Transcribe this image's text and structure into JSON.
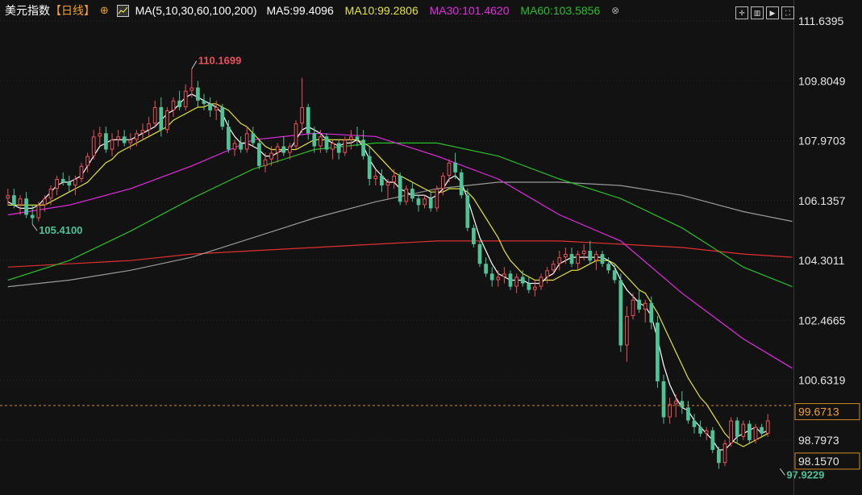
{
  "header": {
    "title": "美元指数",
    "period": "【日线】",
    "settings_icon": "gear-icon",
    "ma_params": "MA(5,10,30,60,100,200)",
    "ma5": "MA5:99.4096",
    "ma10": "MA10:99.2806",
    "ma30": "MA30:101.4620",
    "ma60": "MA60:103.5856",
    "collapse": "⊗",
    "toolbar_icons": [
      "crosshair-icon",
      "panel-icon",
      "play-icon",
      "fullscreen-icon"
    ]
  },
  "colors": {
    "background": "#121212",
    "grid": "#2a2a2a",
    "up": "#e8525a",
    "down": "#4ec397",
    "ma5": "#ffffff",
    "ma10": "#e4e43a",
    "ma30": "#e42be0",
    "ma60": "#2bbf2b",
    "ma100": "#9a9a9a",
    "ma200": "#e03030",
    "title": "#ffffff",
    "period": "#f0a030"
  },
  "chart_data": {
    "type": "candlestick",
    "ylim": [
      97.6,
      111.9
    ],
    "y_ticks": [
      "111.6395",
      "109.8049",
      "107.9703",
      "106.1357",
      "104.3011",
      "102.4665",
      "100.6319",
      "98.7973"
    ],
    "y_tick_values": [
      111.6395,
      109.8049,
      107.9703,
      106.1357,
      104.3011,
      102.4665,
      100.6319,
      98.7973
    ],
    "current_price": "99.6713",
    "current_value": 99.6713,
    "min_label": "98.1570",
    "min_value": 98.157,
    "annotations": [
      {
        "label": "110.1699",
        "index": 30,
        "value": 110.1699,
        "kind": "high"
      },
      {
        "label": "105.4100",
        "index": 4,
        "value": 105.41,
        "kind": "low"
      },
      {
        "label": "97.9229",
        "index": 126,
        "value": 97.9229,
        "kind": "low"
      }
    ],
    "ohlc": [
      [
        106.2,
        106.5,
        106.0,
        106.3
      ],
      [
        106.3,
        106.5,
        105.9,
        106.0
      ],
      [
        106.0,
        106.3,
        105.7,
        106.2
      ],
      [
        106.2,
        106.4,
        105.6,
        105.7
      ],
      [
        105.7,
        106.0,
        105.41,
        105.6
      ],
      [
        105.6,
        106.1,
        105.5,
        106.0
      ],
      [
        106.0,
        106.3,
        105.8,
        106.2
      ],
      [
        106.2,
        106.6,
        106.0,
        106.5
      ],
      [
        106.5,
        106.9,
        106.3,
        106.8
      ],
      [
        106.8,
        107.0,
        106.6,
        106.7
      ],
      [
        106.7,
        106.9,
        106.4,
        106.6
      ],
      [
        106.6,
        106.9,
        106.3,
        106.8
      ],
      [
        106.8,
        107.3,
        106.7,
        107.2
      ],
      [
        107.2,
        107.6,
        107.0,
        107.5
      ],
      [
        107.5,
        108.3,
        107.4,
        108.1
      ],
      [
        108.1,
        108.4,
        107.8,
        108.2
      ],
      [
        108.2,
        108.4,
        107.6,
        107.7
      ],
      [
        107.7,
        108.2,
        107.5,
        108.0
      ],
      [
        108.0,
        108.3,
        107.8,
        108.1
      ],
      [
        108.1,
        108.3,
        107.8,
        107.9
      ],
      [
        107.9,
        108.2,
        107.7,
        108.0
      ],
      [
        108.0,
        108.3,
        107.8,
        108.2
      ],
      [
        108.2,
        108.5,
        108.0,
        108.3
      ],
      [
        108.3,
        108.7,
        108.1,
        108.5
      ],
      [
        108.5,
        109.2,
        108.4,
        109.0
      ],
      [
        109.0,
        109.3,
        108.1,
        108.3
      ],
      [
        108.3,
        109.0,
        108.2,
        108.9
      ],
      [
        108.9,
        109.3,
        108.7,
        109.2
      ],
      [
        109.2,
        109.5,
        108.9,
        109.0
      ],
      [
        109.0,
        109.7,
        108.9,
        109.5
      ],
      [
        109.5,
        110.17,
        109.3,
        109.6
      ],
      [
        109.6,
        109.8,
        109.0,
        109.2
      ],
      [
        109.2,
        109.4,
        108.9,
        109.1
      ],
      [
        109.1,
        109.3,
        108.7,
        108.9
      ],
      [
        108.9,
        109.2,
        108.6,
        109.0
      ],
      [
        109.0,
        109.1,
        108.3,
        108.4
      ],
      [
        108.4,
        108.6,
        107.6,
        107.7
      ],
      [
        107.7,
        108.0,
        107.5,
        107.9
      ],
      [
        107.9,
        108.1,
        107.6,
        107.7
      ],
      [
        107.7,
        108.4,
        107.6,
        108.2
      ],
      [
        108.2,
        108.4,
        107.8,
        107.9
      ],
      [
        107.9,
        108.0,
        107.1,
        107.2
      ],
      [
        107.2,
        107.6,
        107.0,
        107.4
      ],
      [
        107.4,
        107.8,
        107.2,
        107.6
      ],
      [
        107.6,
        107.9,
        107.3,
        107.8
      ],
      [
        107.8,
        108.1,
        107.5,
        107.6
      ],
      [
        107.6,
        107.9,
        107.4,
        107.8
      ],
      [
        107.8,
        108.6,
        107.7,
        108.5
      ],
      [
        108.5,
        109.9,
        108.2,
        109.0
      ],
      [
        109.0,
        109.1,
        108.0,
        108.2
      ],
      [
        108.2,
        108.4,
        107.6,
        107.8
      ],
      [
        107.8,
        108.3,
        107.6,
        108.1
      ],
      [
        108.1,
        108.2,
        107.6,
        107.7
      ],
      [
        107.7,
        108.0,
        107.4,
        107.9
      ],
      [
        107.9,
        108.0,
        107.4,
        107.6
      ],
      [
        107.6,
        108.1,
        107.5,
        108.0
      ],
      [
        108.0,
        108.3,
        107.7,
        108.1
      ],
      [
        108.1,
        108.4,
        107.8,
        108.0
      ],
      [
        108.0,
        108.3,
        107.4,
        107.5
      ],
      [
        107.5,
        107.8,
        106.6,
        106.8
      ],
      [
        106.8,
        107.1,
        106.6,
        106.9
      ],
      [
        106.9,
        107.1,
        106.4,
        106.6
      ],
      [
        106.6,
        106.8,
        106.2,
        106.7
      ],
      [
        106.7,
        107.1,
        106.5,
        106.9
      ],
      [
        106.9,
        107.0,
        106.0,
        106.1
      ],
      [
        106.1,
        106.6,
        106.0,
        106.5
      ],
      [
        106.5,
        106.7,
        106.1,
        106.2
      ],
      [
        106.2,
        106.3,
        105.8,
        106.0
      ],
      [
        106.0,
        106.3,
        105.9,
        106.2
      ],
      [
        106.2,
        106.4,
        105.8,
        105.9
      ],
      [
        105.9,
        106.6,
        105.8,
        106.5
      ],
      [
        106.5,
        107.0,
        106.3,
        106.9
      ],
      [
        106.9,
        107.4,
        106.7,
        107.3
      ],
      [
        107.3,
        107.6,
        106.8,
        107.0
      ],
      [
        107.0,
        107.1,
        106.2,
        106.3
      ],
      [
        106.3,
        106.5,
        105.2,
        105.3
      ],
      [
        105.3,
        105.4,
        104.7,
        104.8
      ],
      [
        104.8,
        104.9,
        104.1,
        104.2
      ],
      [
        104.2,
        104.4,
        103.8,
        103.9
      ],
      [
        103.9,
        104.1,
        103.5,
        103.7
      ],
      [
        103.7,
        104.0,
        103.5,
        103.8
      ],
      [
        103.8,
        104.1,
        103.6,
        103.9
      ],
      [
        103.9,
        104.0,
        103.4,
        103.5
      ],
      [
        103.5,
        103.9,
        103.3,
        103.8
      ],
      [
        103.8,
        104.0,
        103.5,
        103.6
      ],
      [
        103.6,
        103.8,
        103.3,
        103.4
      ],
      [
        103.4,
        103.7,
        103.2,
        103.5
      ],
      [
        103.5,
        103.9,
        103.4,
        103.8
      ],
      [
        103.8,
        104.1,
        103.6,
        104.0
      ],
      [
        104.0,
        104.3,
        103.9,
        104.2
      ],
      [
        104.2,
        104.6,
        104.0,
        104.4
      ],
      [
        104.4,
        104.7,
        104.2,
        104.5
      ],
      [
        104.5,
        104.7,
        104.1,
        104.2
      ],
      [
        104.2,
        104.6,
        104.0,
        104.5
      ],
      [
        104.5,
        104.8,
        104.3,
        104.6
      ],
      [
        104.6,
        104.9,
        104.2,
        104.3
      ],
      [
        104.3,
        104.6,
        104.0,
        104.5
      ],
      [
        104.5,
        104.6,
        104.1,
        104.2
      ],
      [
        104.2,
        104.4,
        103.9,
        104.0
      ],
      [
        104.0,
        104.2,
        103.6,
        103.7
      ],
      [
        103.7,
        103.9,
        101.5,
        101.7
      ],
      [
        101.7,
        102.9,
        101.2,
        102.6
      ],
      [
        102.6,
        103.3,
        102.5,
        103.1
      ],
      [
        103.1,
        103.4,
        102.7,
        102.8
      ],
      [
        102.8,
        103.1,
        102.4,
        103.0
      ],
      [
        103.0,
        103.2,
        102.2,
        102.4
      ],
      [
        102.4,
        102.6,
        100.4,
        100.6
      ],
      [
        100.6,
        100.8,
        99.3,
        99.5
      ],
      [
        99.5,
        100.1,
        99.3,
        99.9
      ],
      [
        99.9,
        100.2,
        99.5,
        100.0
      ],
      [
        100.0,
        100.3,
        99.6,
        99.8
      ],
      [
        99.8,
        100.0,
        99.3,
        99.4
      ],
      [
        99.4,
        99.6,
        99.0,
        99.2
      ],
      [
        99.2,
        99.4,
        98.9,
        99.0
      ],
      [
        99.0,
        99.2,
        98.8,
        99.1
      ],
      [
        99.1,
        99.2,
        98.4,
        98.5
      ],
      [
        98.5,
        98.6,
        97.92,
        98.1
      ],
      [
        98.1,
        98.8,
        98.0,
        98.7
      ],
      [
        98.7,
        99.5,
        98.6,
        99.4
      ],
      [
        99.4,
        99.5,
        98.7,
        98.9
      ],
      [
        98.9,
        99.4,
        98.8,
        99.3
      ],
      [
        99.3,
        99.4,
        98.7,
        98.8
      ],
      [
        98.8,
        99.3,
        98.7,
        99.2
      ],
      [
        99.2,
        99.3,
        98.9,
        99.0
      ],
      [
        99.0,
        99.6,
        98.9,
        99.4
      ]
    ],
    "ma_lines": {
      "ma5": [
        106.1,
        106.0,
        105.9,
        105.9,
        105.9,
        106.0,
        106.2,
        106.4,
        106.6,
        106.7,
        106.7,
        106.8,
        106.9,
        107.2,
        107.5,
        107.8,
        107.9,
        108.0,
        108.0,
        108.0,
        108.0,
        108.1,
        108.2,
        108.3,
        108.4,
        108.6,
        108.8,
        108.9,
        109.1,
        109.3,
        109.4,
        109.3,
        109.2,
        109.1,
        109.0,
        108.8,
        108.4,
        108.1,
        107.9,
        107.9,
        107.8,
        107.7,
        107.5,
        107.5,
        107.6,
        107.7,
        107.7,
        108.0,
        108.3,
        108.4,
        108.3,
        108.2,
        108.0,
        107.9,
        107.8,
        107.9,
        107.9,
        108.0,
        107.8,
        107.4,
        107.1,
        106.9,
        106.7,
        106.7,
        106.5,
        106.4,
        106.3,
        106.3,
        106.3,
        106.2,
        106.3,
        106.5,
        106.8,
        106.9,
        106.7,
        106.2,
        105.6,
        105.0,
        104.6,
        104.2,
        103.9,
        103.8,
        103.7,
        103.7,
        103.7,
        103.6,
        103.6,
        103.6,
        103.8,
        103.9,
        104.2,
        104.3,
        104.4,
        104.4,
        104.4,
        104.4,
        104.4,
        104.4,
        104.3,
        104.1,
        103.7,
        103.4,
        103.2,
        103.0,
        102.9,
        102.6,
        101.9,
        101.1,
        100.5,
        100.1,
        99.8,
        99.7,
        99.4,
        99.2,
        99.0,
        98.8,
        98.5,
        98.5,
        98.7,
        98.9,
        99.0,
        99.1,
        99.2,
        99.0,
        99.1
      ],
      "ma10": [
        106.0,
        106.0,
        106.0,
        106.0,
        106.0,
        106.0,
        106.0,
        106.1,
        106.2,
        106.3,
        106.4,
        106.5,
        106.6,
        106.7,
        106.9,
        107.1,
        107.3,
        107.4,
        107.6,
        107.7,
        107.8,
        107.9,
        108.0,
        108.1,
        108.2,
        108.3,
        108.4,
        108.6,
        108.7,
        108.8,
        108.9,
        109.0,
        109.0,
        109.1,
        109.1,
        109.0,
        108.9,
        108.7,
        108.5,
        108.4,
        108.2,
        108.0,
        107.8,
        107.7,
        107.7,
        107.7,
        107.7,
        107.7,
        107.8,
        107.9,
        108.0,
        108.0,
        108.0,
        108.0,
        108.0,
        108.0,
        108.0,
        108.0,
        107.9,
        107.8,
        107.6,
        107.4,
        107.2,
        107.0,
        106.9,
        106.8,
        106.7,
        106.6,
        106.5,
        106.4,
        106.4,
        106.4,
        106.5,
        106.5,
        106.5,
        106.4,
        106.2,
        105.9,
        105.6,
        105.3,
        105.0,
        104.6,
        104.3,
        104.1,
        103.9,
        103.8,
        103.7,
        103.7,
        103.7,
        103.7,
        103.8,
        103.9,
        104.0,
        104.0,
        104.1,
        104.2,
        104.3,
        104.3,
        104.3,
        104.2,
        104.0,
        103.8,
        103.6,
        103.4,
        103.3,
        103.0,
        102.7,
        102.3,
        101.9,
        101.5,
        101.1,
        100.7,
        100.4,
        100.1,
        99.9,
        99.6,
        99.3,
        99.0,
        98.8,
        98.7,
        98.6,
        98.7,
        98.8,
        98.9,
        99.0
      ]
    },
    "ma_curves": {
      "ma30": [
        [
          0,
          105.7
        ],
        [
          10,
          106.0
        ],
        [
          20,
          106.5
        ],
        [
          30,
          107.2
        ],
        [
          40,
          108.0
        ],
        [
          50,
          108.2
        ],
        [
          60,
          108.1
        ],
        [
          70,
          107.5
        ],
        [
          80,
          106.8
        ],
        [
          90,
          105.7
        ],
        [
          100,
          104.9
        ],
        [
          110,
          103.3
        ],
        [
          120,
          101.9
        ],
        [
          128,
          101.0
        ]
      ],
      "ma60": [
        [
          0,
          103.7
        ],
        [
          10,
          104.3
        ],
        [
          20,
          105.2
        ],
        [
          30,
          106.2
        ],
        [
          40,
          107.1
        ],
        [
          50,
          107.7
        ],
        [
          60,
          107.9
        ],
        [
          70,
          107.9
        ],
        [
          80,
          107.5
        ],
        [
          90,
          106.8
        ],
        [
          100,
          106.2
        ],
        [
          110,
          105.3
        ],
        [
          120,
          104.1
        ],
        [
          128,
          103.5
        ]
      ],
      "ma100": [
        [
          0,
          103.5
        ],
        [
          10,
          103.7
        ],
        [
          20,
          104.0
        ],
        [
          30,
          104.4
        ],
        [
          40,
          105.0
        ],
        [
          50,
          105.6
        ],
        [
          60,
          106.1
        ],
        [
          70,
          106.5
        ],
        [
          80,
          106.7
        ],
        [
          90,
          106.7
        ],
        [
          100,
          106.6
        ],
        [
          110,
          106.3
        ],
        [
          120,
          105.8
        ],
        [
          128,
          105.5
        ]
      ],
      "ma200": [
        [
          0,
          104.1
        ],
        [
          10,
          104.2
        ],
        [
          20,
          104.3
        ],
        [
          30,
          104.5
        ],
        [
          40,
          104.6
        ],
        [
          50,
          104.7
        ],
        [
          60,
          104.8
        ],
        [
          70,
          104.9
        ],
        [
          80,
          104.9
        ],
        [
          90,
          104.9
        ],
        [
          100,
          104.8
        ],
        [
          110,
          104.7
        ],
        [
          120,
          104.5
        ],
        [
          128,
          104.4
        ]
      ]
    }
  }
}
